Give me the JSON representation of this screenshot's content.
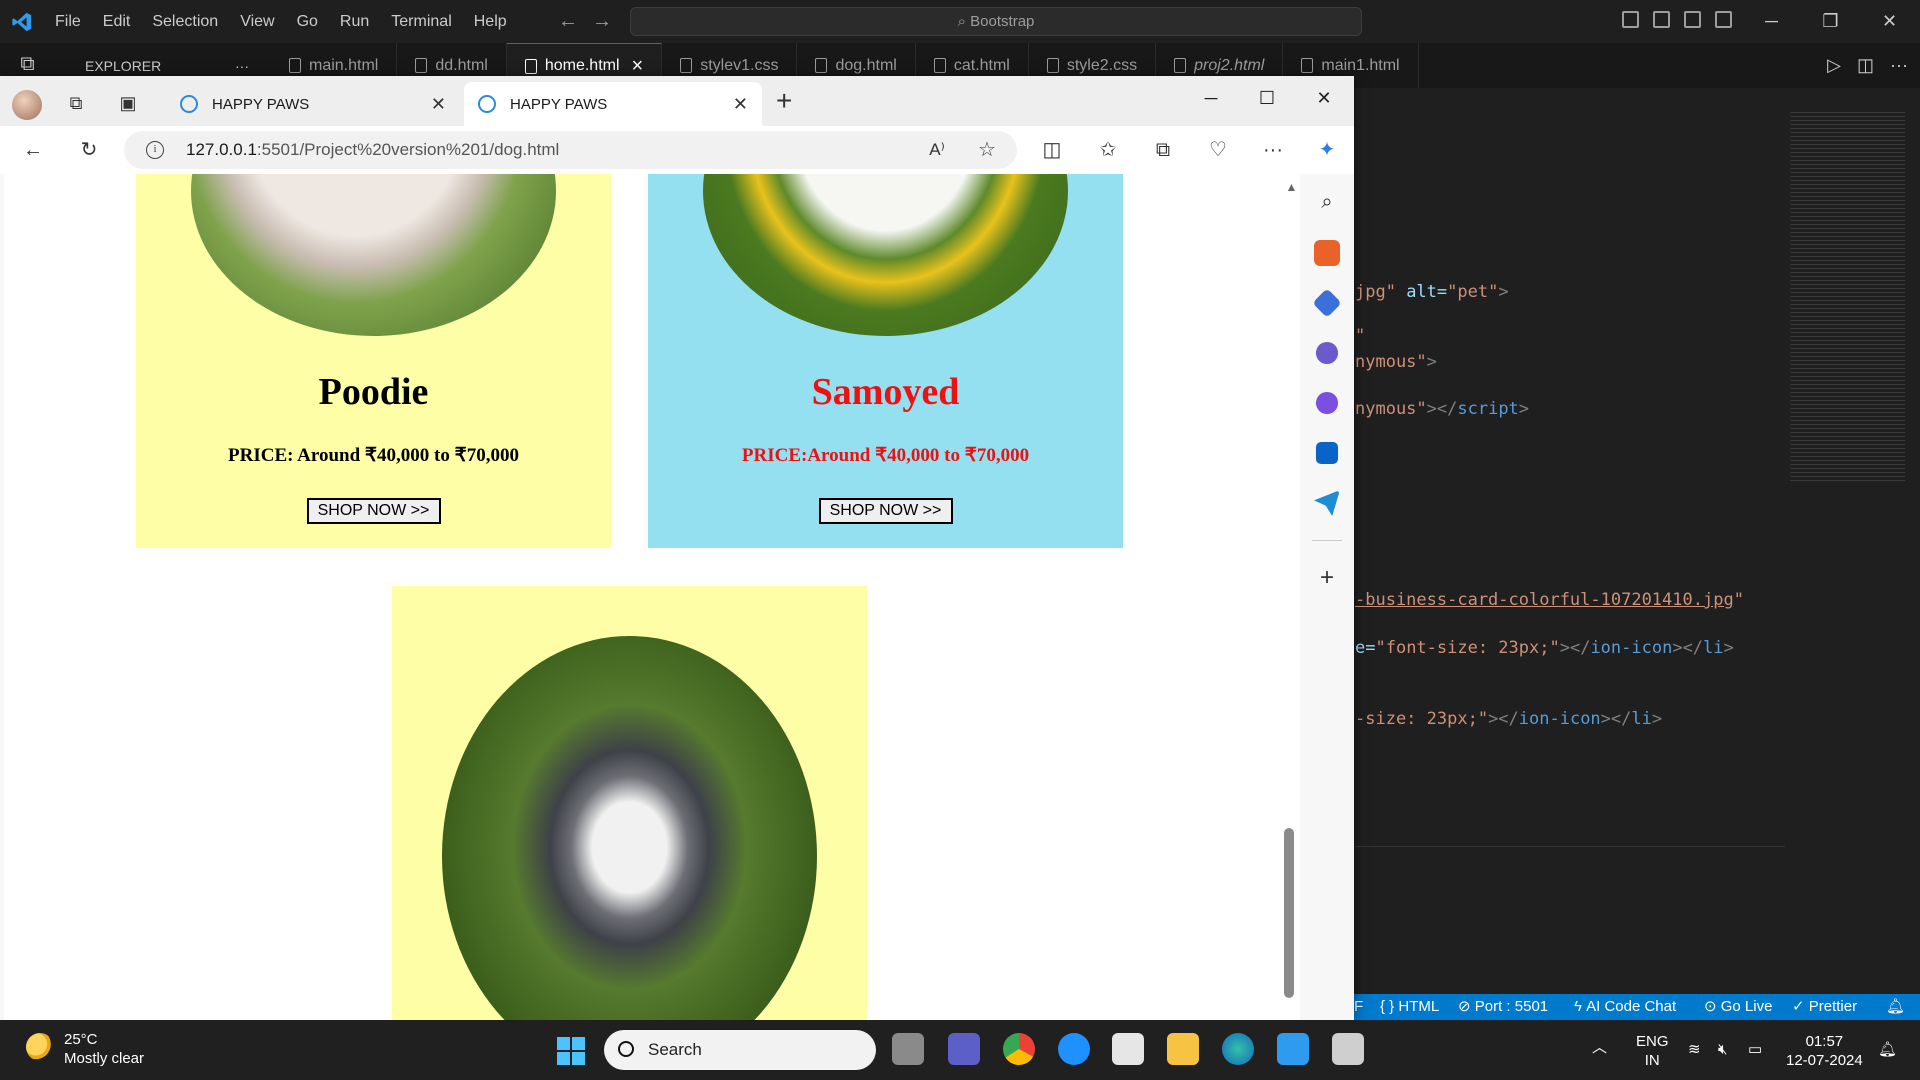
{
  "vscode": {
    "menu": [
      "File",
      "Edit",
      "Selection",
      "View",
      "Go",
      "Run",
      "Terminal",
      "Help"
    ],
    "command_center": "Bootstrap",
    "explorer_label": "EXPLORER",
    "explorer_more": "···",
    "tabs": [
      {
        "label": "main.html",
        "active": false,
        "italic": false
      },
      {
        "label": "dd.html",
        "active": false,
        "italic": false
      },
      {
        "label": "home.html",
        "active": true,
        "italic": false
      },
      {
        "label": "stylev1.css",
        "active": false,
        "italic": false
      },
      {
        "label": "dog.html",
        "active": false,
        "italic": false
      },
      {
        "label": "cat.html",
        "active": false,
        "italic": false
      },
      {
        "label": "style2.css",
        "active": false,
        "italic": false
      },
      {
        "label": "proj2.html",
        "active": false,
        "italic": true
      },
      {
        "label": "main1.html",
        "active": false,
        "italic": false
      }
    ],
    "active_tab_close": "×",
    "code": {
      "l1_str": "jpg\"",
      "l1_attr": " alt=",
      "l1_val": "\"pet\"",
      "l1_end": ">",
      "l2": "\"",
      "l3_str": "nymous\"",
      "l3_end": ">",
      "l4_str": "nymous\"",
      "l4_end": "></",
      "l4_tag": "script",
      "l4_close": ">",
      "l5_link": "-business-card-colorful-107201410.jpg",
      "l5_quote": "\"",
      "l6_a": "e=",
      "l6_str": "\"font-size: 23px;\"",
      "l6_end": "></",
      "l6_tag1": "ion-icon",
      "l6_mid": "></",
      "l6_tag2": "li",
      "l6_close": ">",
      "l7_str": "-size: 23px;\"",
      "l7_end": "></",
      "l7_tag1": "ion-icon",
      "l7_mid": "></",
      "l7_tag2": "li",
      "l7_close": ">"
    },
    "status": {
      "lang": "HTML",
      "port": "Port : 5501",
      "ai": "AI Code Chat",
      "golive": "Go Live",
      "prettier": "Prettier"
    },
    "window_controls": [
      "─",
      "❐",
      "✕"
    ]
  },
  "browser": {
    "tabs": [
      {
        "title": "HAPPY PAWS",
        "active": false
      },
      {
        "title": "HAPPY PAWS",
        "active": true
      }
    ],
    "tab_close": "✕",
    "new_tab": "+",
    "window_controls": [
      "─",
      "☐",
      "✕"
    ],
    "url_host": "127.0.0.1",
    "url_path": ":5501/Project%20version%201/dog.html",
    "page": {
      "cards": [
        {
          "name": "Poodie",
          "price": "PRICE: Around ₹40,000 to ₹70,000",
          "button": "SHOP NOW >>",
          "bg": "#fdfea6",
          "text_color": "#000000"
        },
        {
          "name": "Samoyed",
          "price": "PRICE:Around ₹40,000 to ₹70,000",
          "button": "SHOP NOW >>",
          "bg": "#94e0f0",
          "text_color": "#ee1111"
        },
        {
          "bg": "#fdfea6"
        }
      ]
    }
  },
  "taskbar": {
    "temp": "25°C",
    "condition": "Mostly clear",
    "search_placeholder": "Search",
    "lang_top": "ENG",
    "lang_bottom": "IN",
    "time": "01:57",
    "date": "12-07-2024"
  }
}
